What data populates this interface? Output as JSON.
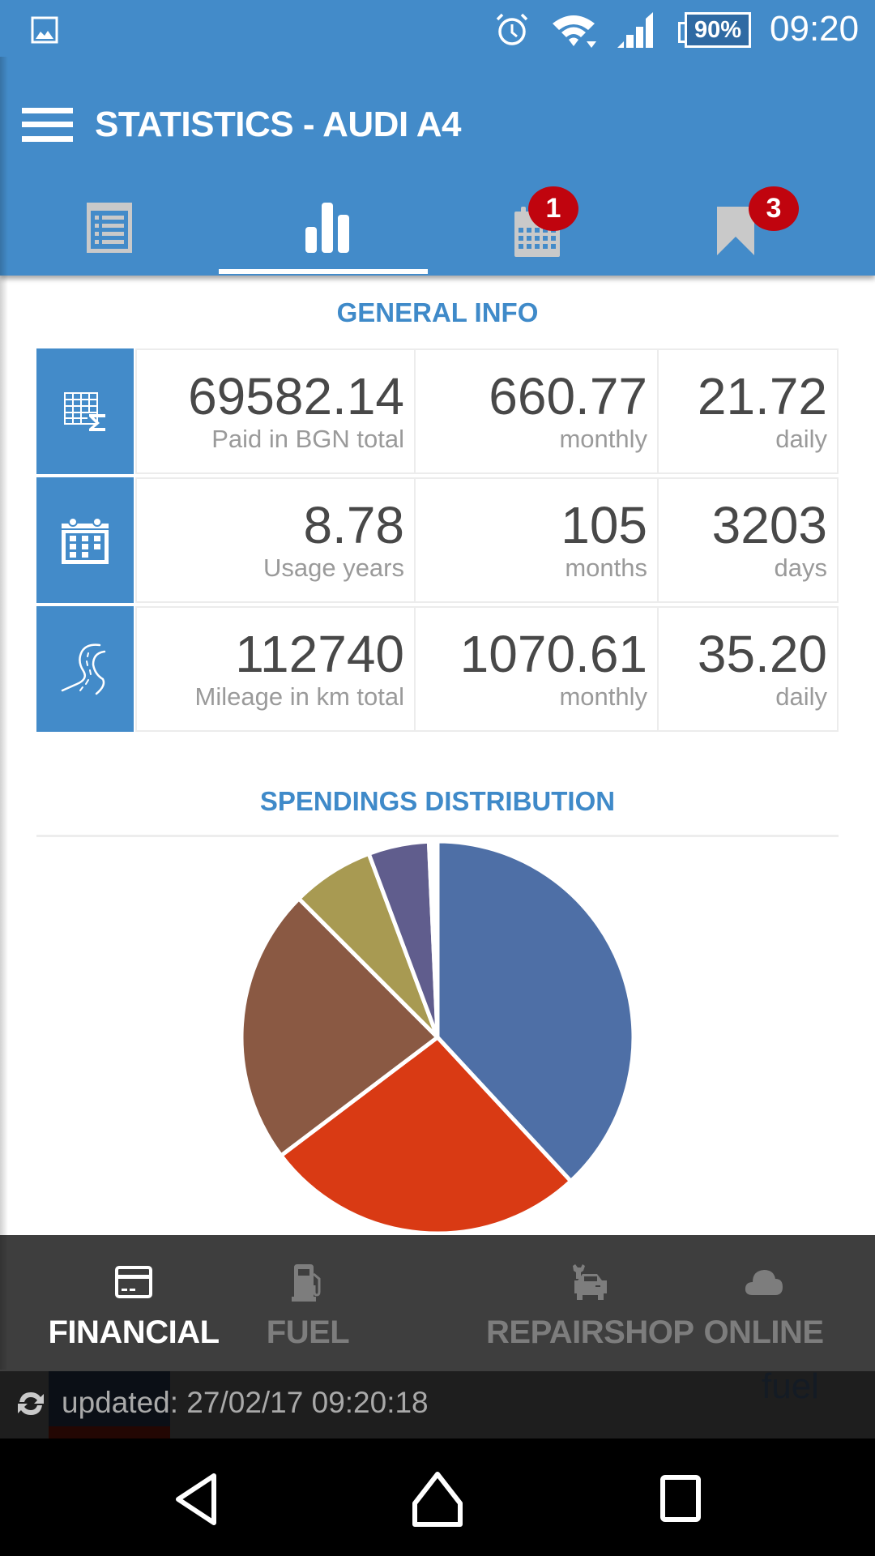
{
  "status_bar": {
    "time": "09:20",
    "battery": "90%",
    "icons": [
      "gallery-notification-icon",
      "alarm-icon",
      "wifi-icon",
      "signal-icon",
      "battery-icon"
    ]
  },
  "app_bar": {
    "title": "STATISTICS - AUDI A4",
    "menu_icon": "hamburger-menu-icon",
    "brand_color": "#438bc9"
  },
  "tabs": [
    {
      "name": "list",
      "icon": "list-icon",
      "badge": null,
      "active": false
    },
    {
      "name": "statistics",
      "icon": "bar-chart-icon",
      "badge": null,
      "active": true
    },
    {
      "name": "calendar",
      "icon": "calendar-icon",
      "badge": "1",
      "active": false
    },
    {
      "name": "bookmarks",
      "icon": "bookmark-icon",
      "badge": "3",
      "active": false
    }
  ],
  "general_info": {
    "title": "GENERAL INFO",
    "rows": [
      {
        "icon": "table-sum-icon",
        "cells": [
          {
            "value": "69582.14",
            "label": "Paid in BGN total"
          },
          {
            "value": "660.77",
            "label": "monthly"
          },
          {
            "value": "21.72",
            "label": "daily"
          }
        ]
      },
      {
        "icon": "calendar-icon",
        "cells": [
          {
            "value": "8.78",
            "label": "Usage years"
          },
          {
            "value": "105",
            "label": "months"
          },
          {
            "value": "3203",
            "label": "days"
          }
        ]
      },
      {
        "icon": "road-icon",
        "cells": [
          {
            "value": "112740",
            "label": "Mileage in km total"
          },
          {
            "value": "1070.61",
            "label": "monthly"
          },
          {
            "value": "35.20",
            "label": "daily"
          }
        ]
      }
    ]
  },
  "spendings": {
    "title": "SPENDINGS DISTRIBUTION",
    "legend_visible_fragment": "fuel"
  },
  "chart_data": {
    "type": "pie",
    "title": "SPENDINGS DISTRIBUTION",
    "start_angle_deg": 0,
    "direction": "clockwise",
    "slices": [
      {
        "name": "slice-1",
        "percent": 38.1,
        "color": "#4e6fa6"
      },
      {
        "name": "slice-2",
        "percent": 26.6,
        "color": "#d93a14"
      },
      {
        "name": "slice-3",
        "percent": 22.8,
        "color": "#8a5943"
      },
      {
        "name": "slice-4",
        "percent": 6.8,
        "color": "#a89a52"
      },
      {
        "name": "slice-5",
        "percent": 5.0,
        "color": "#605d8d"
      },
      {
        "name": "slice-6",
        "percent": 0.7,
        "color": "#ffffff"
      }
    ],
    "legend": "partially hidden below"
  },
  "bottom_nav": {
    "items": [
      {
        "label": "FINANCIAL",
        "icon": "credit-card-icon",
        "active": true
      },
      {
        "label": "FUEL",
        "icon": "fuel-pump-icon",
        "active": false
      },
      {
        "label": "REPAIRSHOP",
        "icon": "car-repair-icon",
        "active": false
      },
      {
        "label": "ONLINE",
        "icon": "cloud-icon",
        "active": false
      }
    ]
  },
  "update_bar": {
    "text": "updated: 27/02/17 09:20:18",
    "icon": "refresh-icon"
  },
  "system_nav": {
    "back": "back-icon",
    "home": "home-icon",
    "recents": "recents-icon"
  }
}
